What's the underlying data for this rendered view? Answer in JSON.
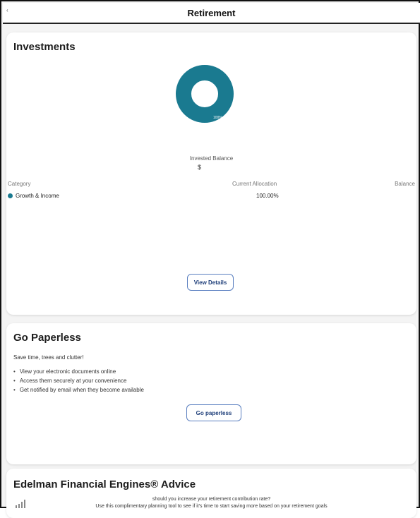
{
  "header": {
    "title": "Retirement"
  },
  "investments": {
    "title": "Investments",
    "donut_label": "100%",
    "invested_balance_label": "Invested Balance",
    "invested_balance_value": "$",
    "columns": {
      "category": "Category",
      "current_allocation": "Current Allocation",
      "balance": "Balance"
    },
    "rows": [
      {
        "category": "Growth & Income",
        "allocation": "100.00%",
        "balance": "",
        "color": "#1a7a90"
      }
    ],
    "view_details_label": "View Details"
  },
  "paperless": {
    "title": "Go Paperless",
    "subtitle": "Save time, trees and clutter!",
    "bullets": [
      "View your electronic documents online",
      "Access them securely at your convenience",
      "Get notified by email when they become available"
    ],
    "button_label": "Go paperless"
  },
  "advice": {
    "title": "Edelman Financial Engines® Advice",
    "question": "should you increase your retirement contribution rate?",
    "text": "Use this complimentary planning tool to see if it's time to start saving more based on your retirement goals"
  },
  "colors": {
    "accent": "#1a7a90",
    "button_border": "#5a7fc0",
    "button_text": "#1f3f7a"
  }
}
